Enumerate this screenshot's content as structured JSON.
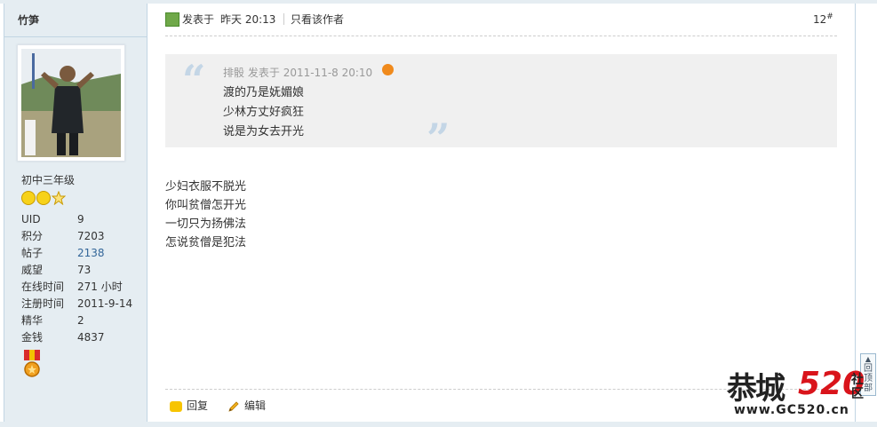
{
  "author": {
    "name": "竹笋",
    "group": "初中三年级",
    "stats": [
      {
        "key": "UID",
        "value": "9",
        "link": false
      },
      {
        "key": "积分",
        "value": "7203",
        "link": false
      },
      {
        "key": "帖子",
        "value": "2138",
        "link": true
      },
      {
        "key": "威望",
        "value": "73",
        "link": false
      },
      {
        "key": "在线时间",
        "value": "271 小时",
        "link": false
      },
      {
        "key": "注册时间",
        "value": "2011-9-14",
        "link": false
      },
      {
        "key": "精华",
        "value": "2",
        "link": false
      },
      {
        "key": "金钱",
        "value": "4837",
        "link": false
      }
    ]
  },
  "post": {
    "posted_label": "发表于",
    "posted_time": "昨天 20:13",
    "author_only": "只看该作者",
    "floor": "12",
    "floor_suffix": "#",
    "quote": {
      "author": "排骰",
      "posted_label": "发表于",
      "time": "2011-11-8 20:10",
      "lines": [
        "渡的乃是妩媚娘",
        "少林方丈好疯狂",
        "说是为女去开光"
      ]
    },
    "body_lines": [
      "少妇衣服不脱光",
      "你叫贫僧怎开光",
      "一切只为扬佛法",
      "怎说贫僧是犯法"
    ],
    "actions": {
      "reply": "回复",
      "edit": "编辑"
    }
  },
  "to_top": "回顶部",
  "watermark": {
    "logo": "恭城",
    "number": "520",
    "side": "社区",
    "url": "www.GC520.cn"
  }
}
